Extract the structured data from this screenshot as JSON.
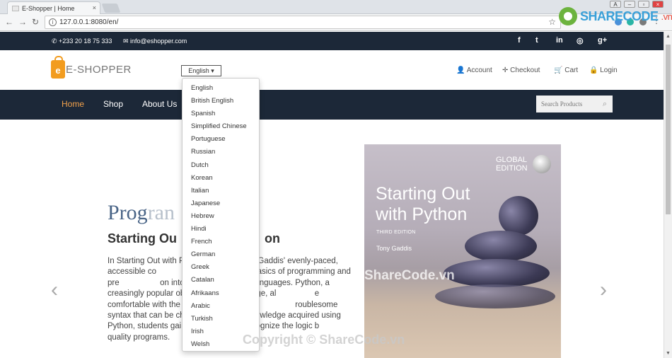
{
  "browser": {
    "tab_title": "E-Shopper | Home",
    "url": "127.0.0.1:8080/en/"
  },
  "watermark": {
    "brand": "SHARECODE",
    "brand_suffix": ".vn",
    "overlay": "ShareCode.vn",
    "copyright": "Copyright © ShareCode.vn"
  },
  "topbar": {
    "phone": "+233 20 18 75 333",
    "email": "info@eshopper.com",
    "social": [
      "f",
      "t",
      "in",
      "◎",
      "g+"
    ]
  },
  "header": {
    "logo": "E-SHOPPER",
    "language_button": "English ▾",
    "links": {
      "account": "Account",
      "checkout": "Checkout",
      "cart": "Cart",
      "login": "Login"
    }
  },
  "nav": {
    "items": [
      "Home",
      "Shop",
      "About Us"
    ],
    "search_placeholder": "Search Products"
  },
  "slide": {
    "title_a": "Prog",
    "title_b": "ran",
    "subtitle": "Starting Ou",
    "subtitle_end": "on",
    "text": "In Starting Out with P                        Tony Gaddis' evenly-paced, accessible co                  students to the basics of programming and pre                  on into more complicated languages. Python, a              creasingly popular object-oriented language, al                 e comfortable with the fundamentals of prog                roublesome syntax that can be challenging fo             owledge acquired using Python, students gain                          recognize the logic b                           quality programs."
  },
  "book": {
    "edition_badge": "GLOBAL EDITION",
    "title": "Starting Out with Python",
    "edition": "THIRD EDITION",
    "author": "Tony Gaddis"
  },
  "languages": [
    "English",
    "British English",
    "Spanish",
    "Simplified Chinese",
    "Portuguese",
    "Russian",
    "Dutch",
    "Korean",
    "Italian",
    "Japanese",
    "Hebrew",
    "Hindi",
    "French",
    "German",
    "Greek",
    "Catalan",
    "Afrikaans",
    "Arabic",
    "Turkish",
    "Irish",
    "Welsh"
  ]
}
